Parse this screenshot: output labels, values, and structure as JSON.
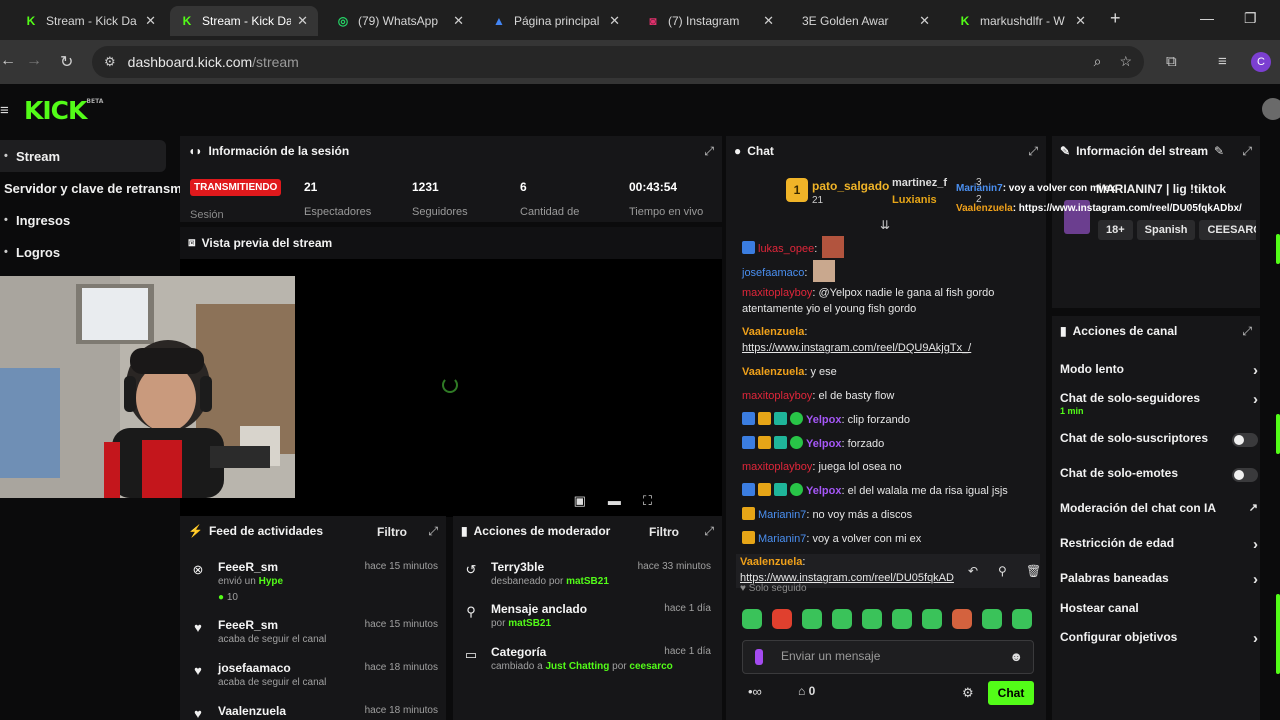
{
  "browser": {
    "tabs": [
      {
        "title": "Stream - Kick Da",
        "icon": "kick-icon",
        "color": "#53fc18",
        "active": false
      },
      {
        "title": "Stream - Kick Da",
        "icon": "kick-icon",
        "color": "#53fc18",
        "active": true
      },
      {
        "title": "(79) WhatsApp",
        "icon": "whatsapp-icon",
        "color": "#25d366",
        "active": false
      },
      {
        "title": "Página principal",
        "icon": "drive-icon",
        "color": "#4285f4",
        "active": false
      },
      {
        "title": "(7) Instagram",
        "icon": "instagram-icon",
        "color": "#e1306c",
        "active": false
      },
      {
        "title": "3E Golden Awar",
        "icon": "3e-icon",
        "color": "#e0752e",
        "active": false
      },
      {
        "title": "markushdlfr - W",
        "icon": "kick-icon",
        "color": "#53fc18",
        "active": false
      }
    ],
    "url_host": "dashboard.kick.com",
    "url_path": "/stream",
    "profile_initial": "C"
  },
  "brand": {
    "logo": "KICK",
    "beta": "BETA"
  },
  "sidebar": {
    "items": [
      {
        "label": "Stream",
        "active": true
      },
      {
        "label": "Servidor y clave de retransm",
        "active": false
      },
      {
        "label": "Ingresos",
        "active": false
      },
      {
        "label": "Logros",
        "active": false
      }
    ]
  },
  "session": {
    "title": "Información de la sesión",
    "live_badge": "TRANSMITIENDO",
    "label_session": "Sesión",
    "stats": [
      {
        "value": "21",
        "label": "Espectadores"
      },
      {
        "value": "1231",
        "label": "Seguidores"
      },
      {
        "value": "6",
        "label": "Cantidad de"
      },
      {
        "value": "00:43:54",
        "label": "Tiempo en vivo"
      }
    ]
  },
  "preview": {
    "title": "Vista previa del stream"
  },
  "activity_feed": {
    "title": "Feed de actividades",
    "filter": "Filtro",
    "items": [
      {
        "name": "FeeeR_sm",
        "line1": "envió un",
        "highlight": "Hype",
        "extra": "10",
        "time": "hace 15 minutos",
        "icon": "kick-circle-icon"
      },
      {
        "name": "FeeeR_sm",
        "line1": "acaba de seguir el canal",
        "time": "hace 15 minutos",
        "icon": "heart-icon"
      },
      {
        "name": "josefaamaco",
        "line1": "acaba de seguir el canal",
        "time": "hace 18 minutos",
        "icon": "heart-icon"
      },
      {
        "name": "Vaalenzuela",
        "line1": "",
        "time": "hace 18 minutos",
        "icon": "heart-icon"
      }
    ]
  },
  "mod_actions": {
    "title": "Acciones de moderador",
    "filter": "Filtro",
    "items": [
      {
        "title": "Terry3ble",
        "pre": "desbaneado por",
        "by": "matSB21",
        "time": "hace 33 minutos",
        "icon": "undo-icon"
      },
      {
        "title": "Mensaje anclado",
        "pre": "por",
        "by": "matSB21",
        "time": "hace 1 día",
        "icon": "pin-icon"
      },
      {
        "title": "Categoría",
        "pre": "cambiado a",
        "by": "Just Chatting",
        "mid": "por",
        "by2": "ceesarco",
        "time": "hace 1 día",
        "icon": "category-icon"
      }
    ]
  },
  "chat": {
    "title": "Chat",
    "leaderboard": [
      {
        "rank": "1",
        "name": "pato_salgado",
        "count": "21"
      },
      {
        "name": "martinez_f",
        "count": "3"
      },
      {
        "name": "Luxianis",
        "count": "2"
      }
    ],
    "messages": [
      {
        "user": "lukas_opee",
        "text": ""
      },
      {
        "user": "josefaamaco",
        "text": ""
      },
      {
        "user": "maxitoplayboy",
        "text": "@Yelpox nadie le gana al fish gordo atentamente yio el young fish gordo"
      },
      {
        "user": "Vaalenzuela",
        "text": "https://www.instagram.com/reel/DQU9AkjgTx_/"
      },
      {
        "user": "Vaalenzuela",
        "text": "y ese"
      },
      {
        "user": "maxitoplayboy",
        "text": "el de basty flow"
      },
      {
        "user": "Yelpox",
        "text": "clip forzando"
      },
      {
        "user": "Yelpox",
        "text": "forzado"
      },
      {
        "user": "maxitoplayboy",
        "text": "juega lol osea no"
      },
      {
        "user": "Yelpox",
        "text": "el del walala me da risa igual jsjs"
      },
      {
        "user": "Marianin7",
        "text": "no voy más a discos"
      },
      {
        "user": "Marianin7",
        "text": "voy a volver con mi ex"
      },
      {
        "user": "Vaalenzuela",
        "text": "https://www.instagram.com/reel/DU05fqkAD"
      }
    ],
    "followers_only": "Solo seguido",
    "input_placeholder": "Enviar un mensaje",
    "viewers_count": "0",
    "send_label": "Chat"
  },
  "stream_info": {
    "title": "Información del stream",
    "stream_title": "MARIANIN7 | lig !tiktok",
    "tags": [
      "18+",
      "Spanish",
      "CEESARC"
    ]
  },
  "channel_actions": {
    "title": "Acciones de canal",
    "rows": [
      {
        "label": "Modo lento",
        "control": "chevron"
      },
      {
        "label": "Chat de solo-seguidores",
        "sub": "1 min",
        "control": "chevron"
      },
      {
        "label": "Chat de solo-suscriptores",
        "control": "toggle"
      },
      {
        "label": "Chat de solo-emotes",
        "control": "toggle"
      },
      {
        "label": "Moderación del chat con IA",
        "control": "external"
      },
      {
        "label": "Restricción de edad",
        "control": "chevron"
      },
      {
        "label": "Palabras baneadas",
        "control": "chevron"
      },
      {
        "label": "Hostear canal",
        "control": "none"
      },
      {
        "label": "Configurar objetivos",
        "control": "chevron"
      }
    ]
  },
  "overlay": {
    "line1_user": "Marianin7",
    "line1_text": ": voy a volver con mi ex",
    "line2_user": "Vaalenzuela",
    "line2_text": ": https://www.instagram.com/reel/DU05fqkADbx/"
  }
}
